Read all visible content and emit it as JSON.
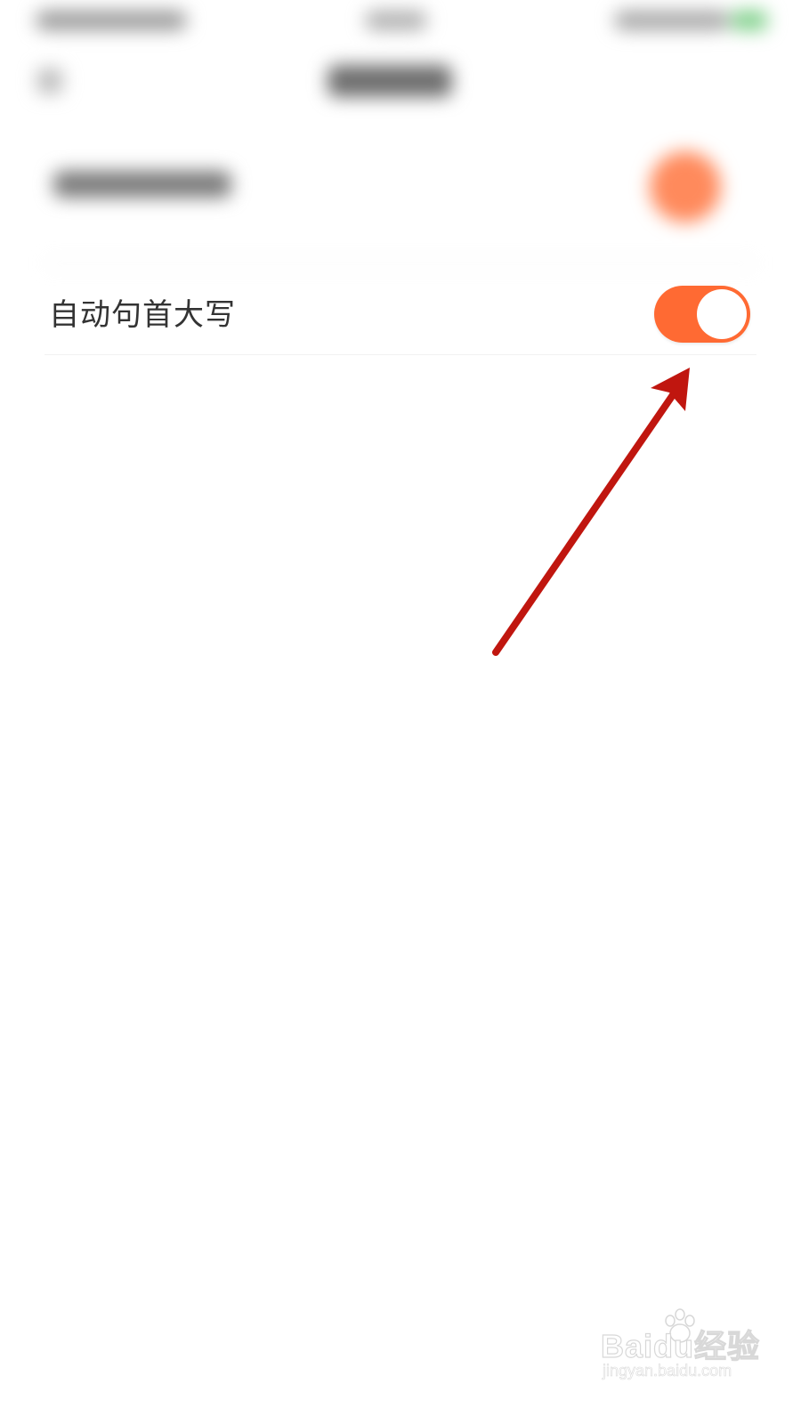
{
  "setting": {
    "label": "自动句首大写",
    "enabled": true
  },
  "colors": {
    "toggle_on": "#ff6a33",
    "arrow": "#c0160f",
    "label_text": "#333333"
  },
  "watermark": {
    "brand": "Baidu经验",
    "url": "jingyan.baidu.com"
  }
}
